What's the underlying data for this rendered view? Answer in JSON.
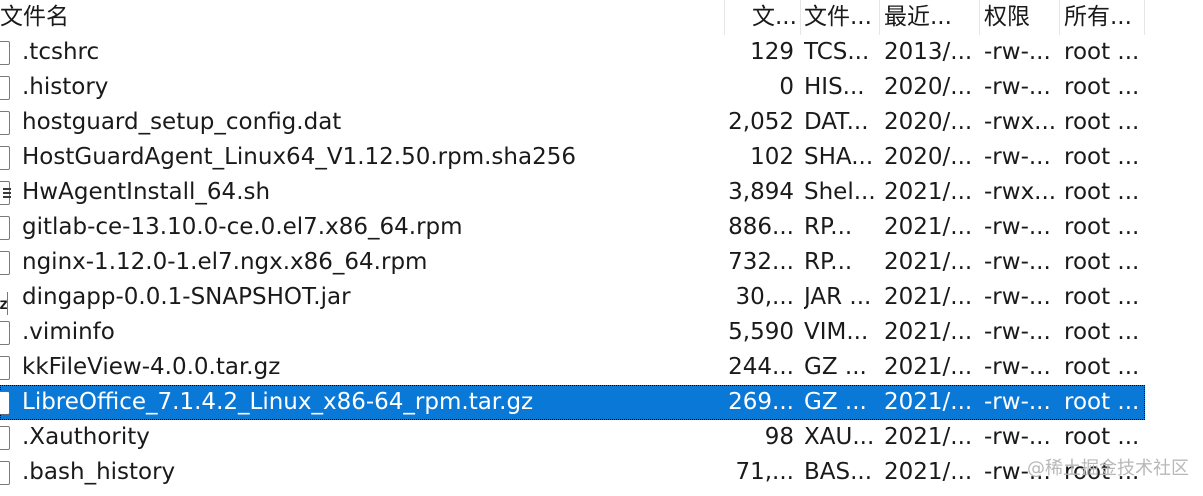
{
  "columns": {
    "name": "文件名",
    "size": "文...",
    "type": "文件...",
    "modified": "最近...",
    "permissions": "权限",
    "owner": "所有..."
  },
  "files": [
    {
      "name": ".tcshrc",
      "size": "129",
      "type": "TCS...",
      "modified": "2013/...",
      "permissions": "-rw-...",
      "owner": "root ...",
      "icon": "file-icon"
    },
    {
      "name": ".history",
      "size": "0",
      "type": "HIS...",
      "modified": "2020/...",
      "permissions": "-rw-...",
      "owner": "root ...",
      "icon": "file-icon"
    },
    {
      "name": "hostguard_setup_config.dat",
      "size": "2,052",
      "type": "DAT...",
      "modified": "2020/...",
      "permissions": "-rwx...",
      "owner": "root ...",
      "icon": "file-icon"
    },
    {
      "name": "HostGuardAgent_Linux64_V1.12.50.rpm.sha256",
      "size": "102",
      "type": "SHA...",
      "modified": "2020/...",
      "permissions": "-rw-...",
      "owner": "root ...",
      "icon": "file-icon"
    },
    {
      "name": "HwAgentInstall_64.sh",
      "size": "3,894",
      "type": "Shel...",
      "modified": "2021/...",
      "permissions": "-rwx...",
      "owner": "root ...",
      "icon": "script-file-icon"
    },
    {
      "name": "gitlab-ce-13.10.0-ce.0.el7.x86_64.rpm",
      "size": "886...",
      "type": "RP...",
      "modified": "2021/...",
      "permissions": "-rw-...",
      "owner": "root ...",
      "icon": "file-icon"
    },
    {
      "name": "nginx-1.12.0-1.el7.ngx.x86_64.rpm",
      "size": "732...",
      "type": "RP...",
      "modified": "2021/...",
      "permissions": "-rw-...",
      "owner": "root ...",
      "icon": "file-icon"
    },
    {
      "name": "dingapp-0.0.1-SNAPSHOT.jar",
      "size": "30,...",
      "type": "JAR ...",
      "modified": "2021/...",
      "permissions": "-rw-...",
      "owner": "root ...",
      "icon": "archive-file-icon",
      "icon_text": "Gz"
    },
    {
      "name": ".viminfo",
      "size": "5,590",
      "type": "VIM...",
      "modified": "2021/...",
      "permissions": "-rw-...",
      "owner": "root ...",
      "icon": "file-icon"
    },
    {
      "name": "kkFileView-4.0.0.tar.gz",
      "size": "244...",
      "type": "GZ ...",
      "modified": "2021/...",
      "permissions": "-rw-...",
      "owner": "root ...",
      "icon": "file-icon"
    },
    {
      "name": "LibreOffice_7.1.4.2_Linux_x86-64_rpm.tar.gz",
      "size": "269...",
      "type": "GZ ...",
      "modified": "2021/...",
      "permissions": "-rw-...",
      "owner": "root ...",
      "icon": "file-icon",
      "selected": true
    },
    {
      "name": ".Xauthority",
      "size": "98",
      "type": "XAU...",
      "modified": "2021/...",
      "permissions": "-rw-...",
      "owner": "root ...",
      "icon": "file-icon"
    },
    {
      "name": ".bash_history",
      "size": "71,...",
      "type": "BAS...",
      "modified": "2021/...",
      "permissions": "-rw-...",
      "owner": "root ...",
      "icon": "file-icon"
    }
  ],
  "watermark": "@稀土掘金技术社区",
  "colors": {
    "selection": "#0a78d7",
    "text": "#1a1a1a",
    "divider": "#e6e6e6"
  }
}
